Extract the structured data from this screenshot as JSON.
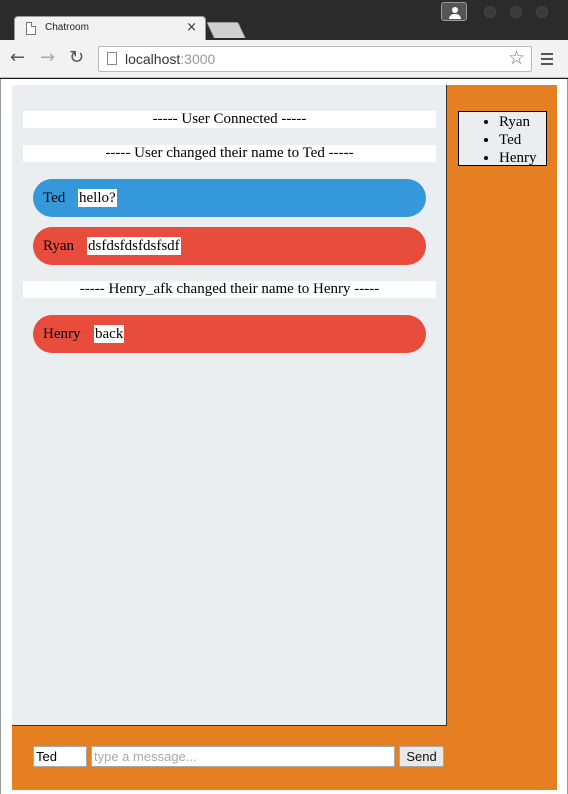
{
  "browser": {
    "tab_title": "Chatroom",
    "tab_close": "×",
    "url_host": "localhost",
    "url_port": ":3000"
  },
  "chat": {
    "events": [
      {
        "type": "notice",
        "text": "----- User Connected -----"
      },
      {
        "type": "notice",
        "text": "----- User changed their name to Ted -----"
      },
      {
        "type": "message",
        "author": "Ted",
        "text": "hello?",
        "color": "#3498db"
      },
      {
        "type": "message",
        "author": "Ryan",
        "text": "dsfdsfdsfdsfsdf",
        "color": "#e74c3c"
      },
      {
        "type": "notice",
        "text": "----- Henry_afk changed their name to Henry -----"
      },
      {
        "type": "message",
        "author": "Henry",
        "text": "back",
        "color": "#e74c3c"
      }
    ]
  },
  "users": [
    "Ryan",
    "Ted",
    "Henry"
  ],
  "composer": {
    "name_value": "Ted",
    "message_placeholder": "type a message...",
    "send_label": "Send"
  },
  "colors": {
    "app_background": "#e67e22",
    "chat_background": "#eaeef0",
    "blue_bubble": "#3498db",
    "red_bubble": "#e74c3c"
  }
}
